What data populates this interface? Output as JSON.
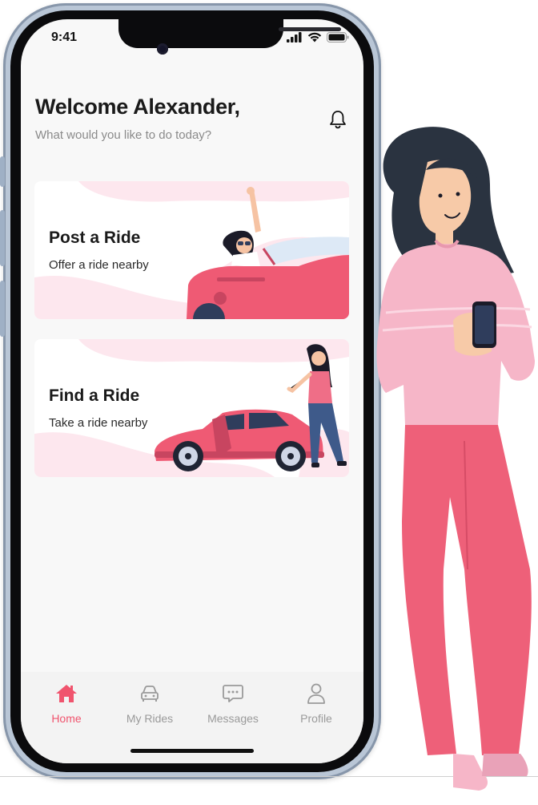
{
  "status_bar": {
    "time": "9:41"
  },
  "header": {
    "greeting": "Welcome Alexander,",
    "subtitle": "What would you like to do today?"
  },
  "cards": [
    {
      "title": "Post a Ride",
      "subtitle": "Offer a ride nearby"
    },
    {
      "title": "Find a Ride",
      "subtitle": "Take a ride nearby"
    }
  ],
  "tabs": [
    {
      "label": "Home",
      "icon": "home-icon",
      "active": true
    },
    {
      "label": "My Rides",
      "icon": "car-icon",
      "active": false
    },
    {
      "label": "Messages",
      "icon": "chat-icon",
      "active": false
    },
    {
      "label": "Profile",
      "icon": "user-icon",
      "active": false
    }
  ],
  "colors": {
    "accent": "#f0546e",
    "pink_light": "#fde7ee",
    "navy": "#2f3d5c"
  }
}
